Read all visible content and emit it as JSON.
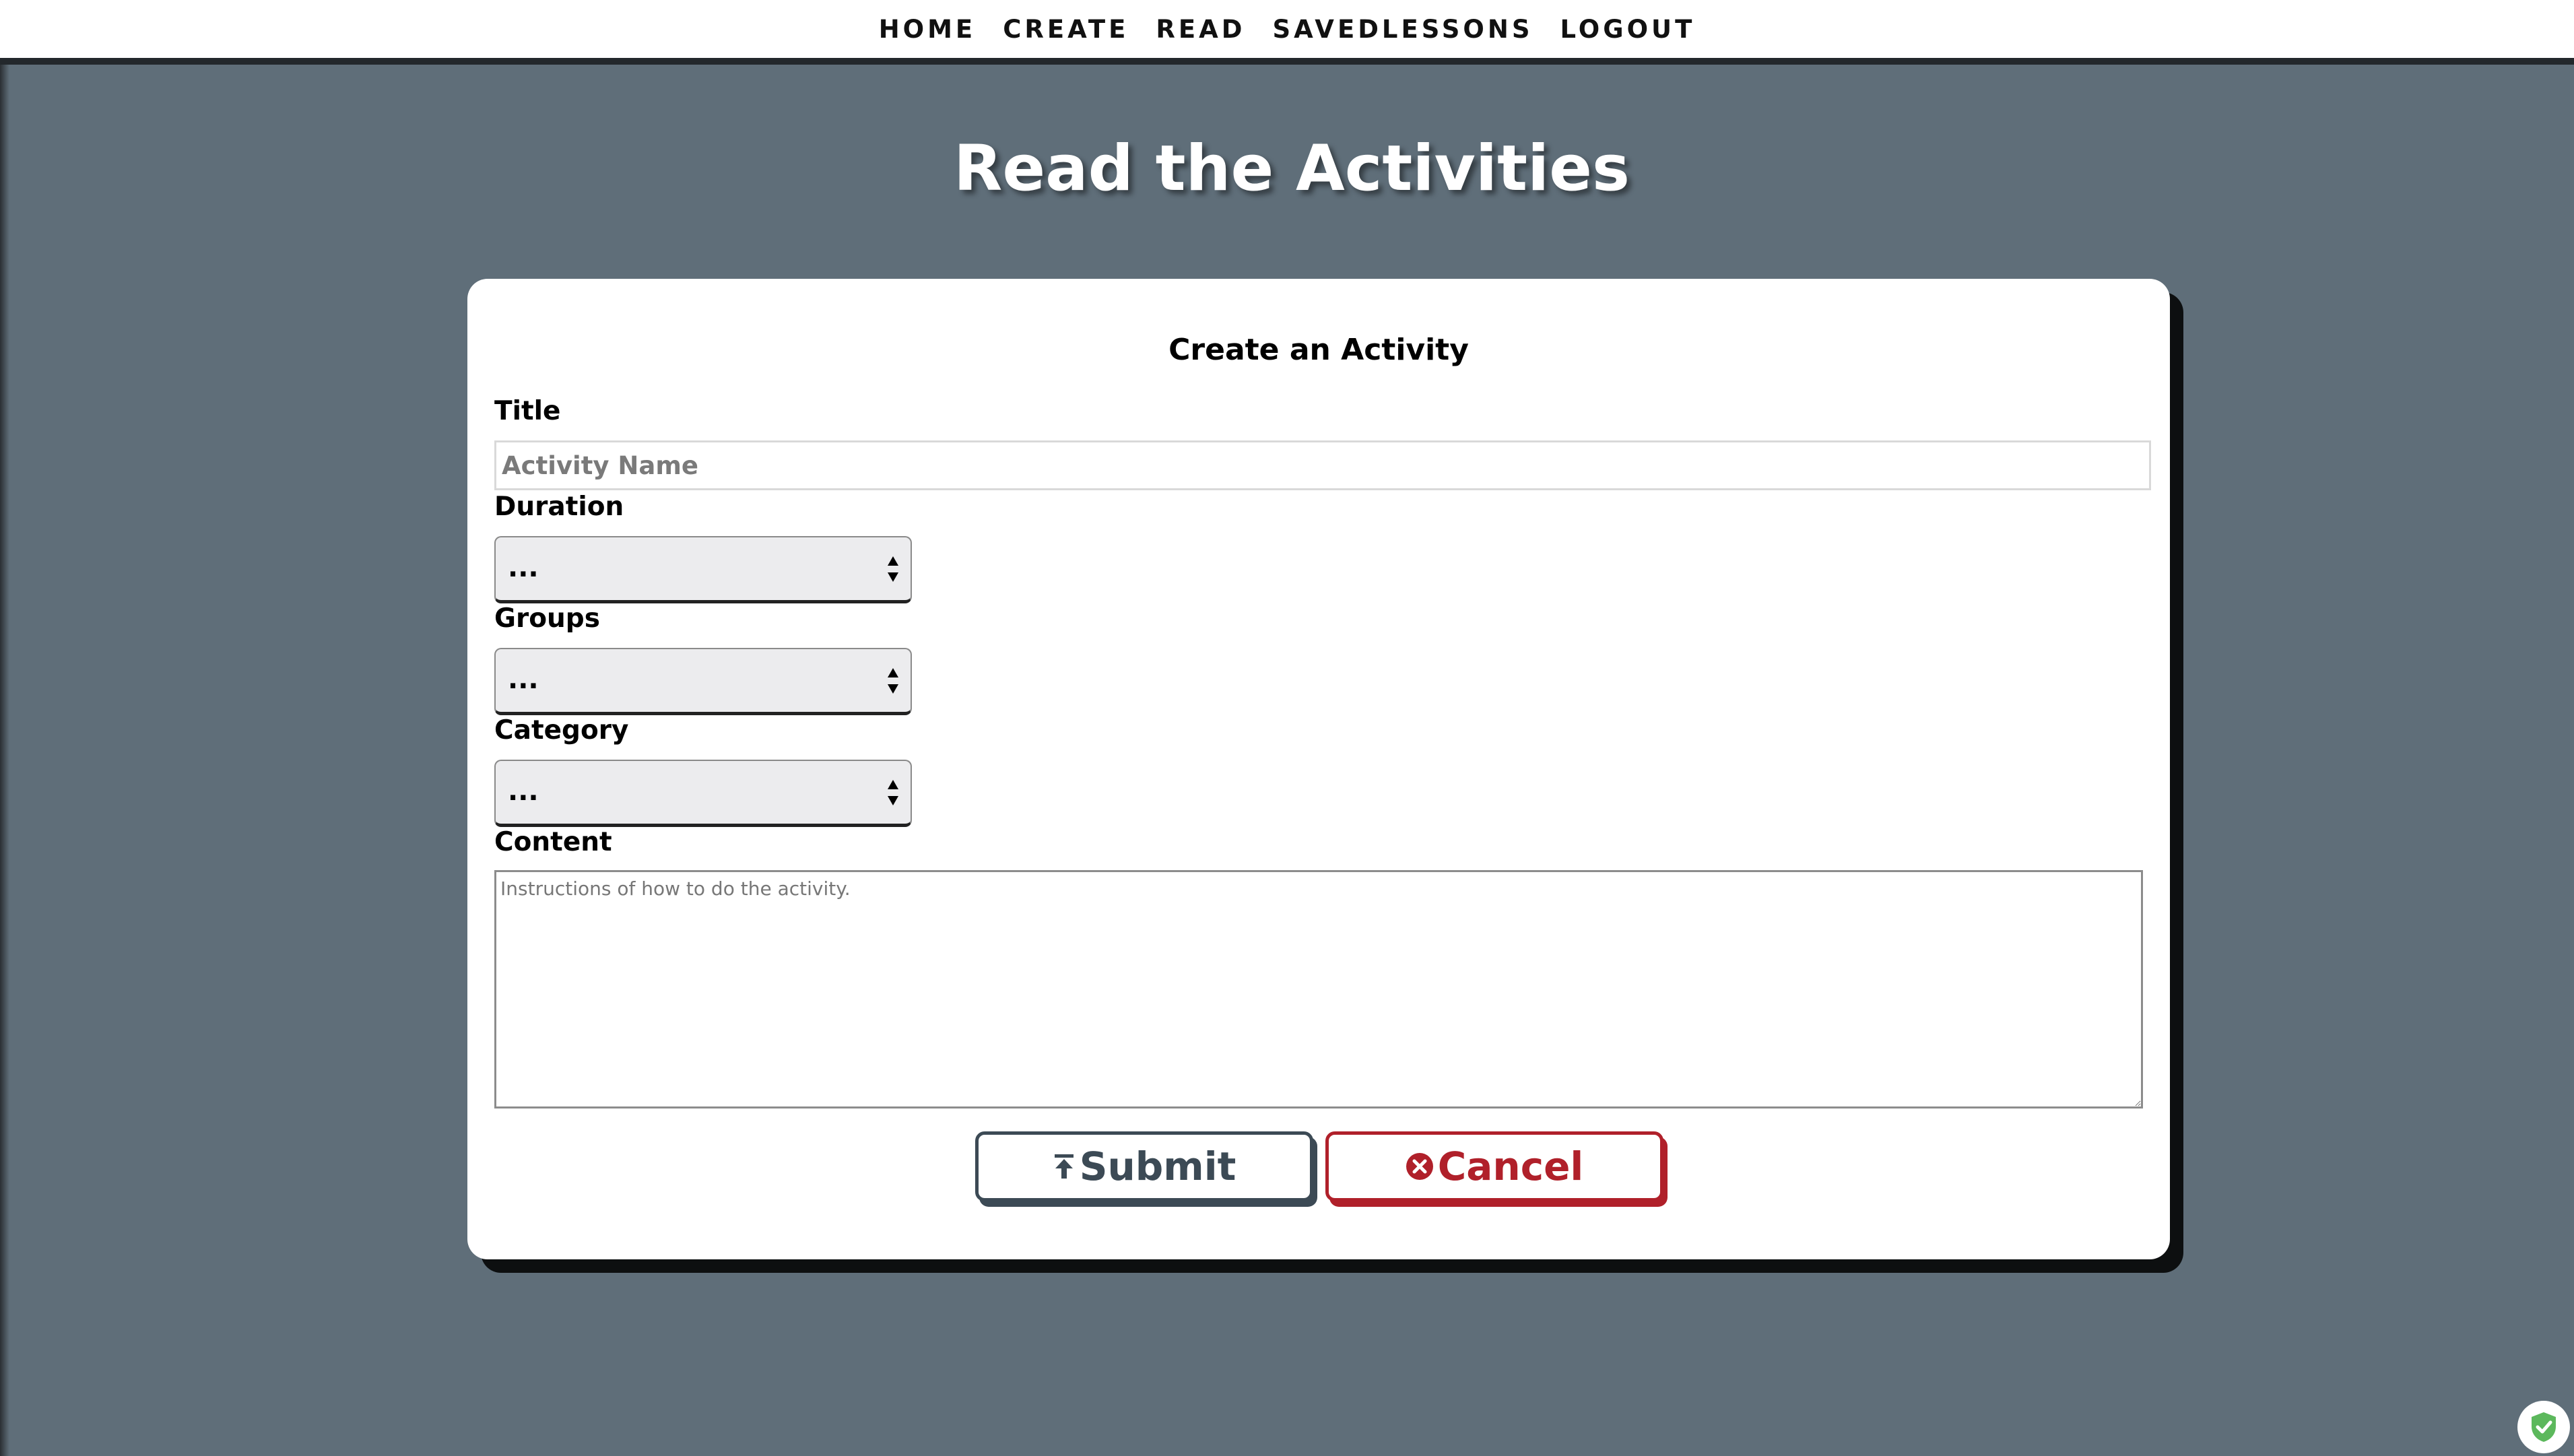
{
  "nav": {
    "items": [
      {
        "label": "HOME"
      },
      {
        "label": "CREATE"
      },
      {
        "label": "READ"
      },
      {
        "label": "SAVEDLESSONS"
      },
      {
        "label": "LOGOUT"
      }
    ]
  },
  "page": {
    "title": "Read the Activities"
  },
  "form": {
    "heading": "Create an Activity",
    "title_label": "Title",
    "title_placeholder": "Activity Name",
    "duration_label": "Duration",
    "duration_value": "...",
    "groups_label": "Groups",
    "groups_value": "...",
    "category_label": "Category",
    "category_value": "...",
    "content_label": "Content",
    "content_placeholder": "Instructions of how to do the activity.",
    "submit_label": "Submit",
    "cancel_label": "Cancel"
  },
  "icons": {
    "submit": "upload-arrow-icon",
    "cancel": "circle-x-icon",
    "select": "sort-arrows-icon",
    "badge": "shield-check-icon"
  },
  "colors": {
    "page_background": "#5f6e79",
    "submit_accent": "#3c4a55",
    "cancel_accent": "#b0202a",
    "badge_accent": "#5cb85c"
  }
}
